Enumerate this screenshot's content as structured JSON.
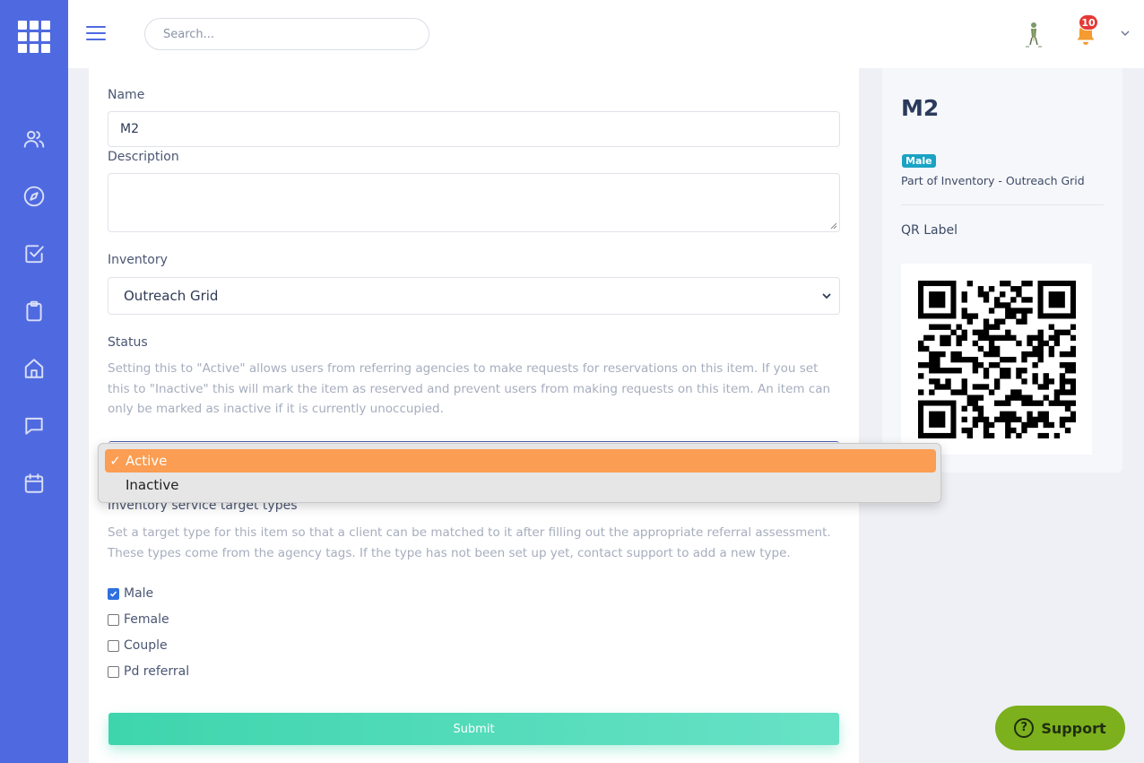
{
  "topbar": {
    "search_placeholder": "Search...",
    "notification_count": "10"
  },
  "form": {
    "name_label": "Name",
    "name_value": "M2",
    "description_label": "Description",
    "description_value": "",
    "inventory_label": "Inventory",
    "inventory_value": "Outreach Grid",
    "status_label": "Status",
    "status_help": "Setting this to \"Active\" allows users from referring agencies to make requests for reservations on this item. If you set this to \"Inactive\" this will mark the item as reserved and prevent users from making requests on this item. An item can only be marked as inactive if it is currently unoccupied.",
    "status_options": [
      {
        "label": "Active",
        "selected": true
      },
      {
        "label": "Inactive",
        "selected": false
      }
    ],
    "target_label": "Inventory service target types",
    "target_help": "Set a target type for this item so that a client can be matched to it after filling out the appropriate referral assessment. These types come from the agency tags. If the type has not been set up yet, contact support to add a new type.",
    "target_types": [
      {
        "label": "Male",
        "checked": true
      },
      {
        "label": "Female",
        "checked": false
      },
      {
        "label": "Couple",
        "checked": false
      },
      {
        "label": "Pd referral",
        "checked": false
      }
    ],
    "submit_label": "Submit"
  },
  "side": {
    "title": "M2",
    "badge": "Male",
    "part_of": "Part of Inventory - Outreach Grid",
    "qr_label": "QR Label"
  },
  "support": {
    "label": "Support"
  },
  "colors": {
    "sidebar": "#4f6ae0",
    "selected_option": "#fb9d52",
    "submit": "#3ed5ad",
    "support": "#7cb01c",
    "badge": "#1aa3c4"
  }
}
